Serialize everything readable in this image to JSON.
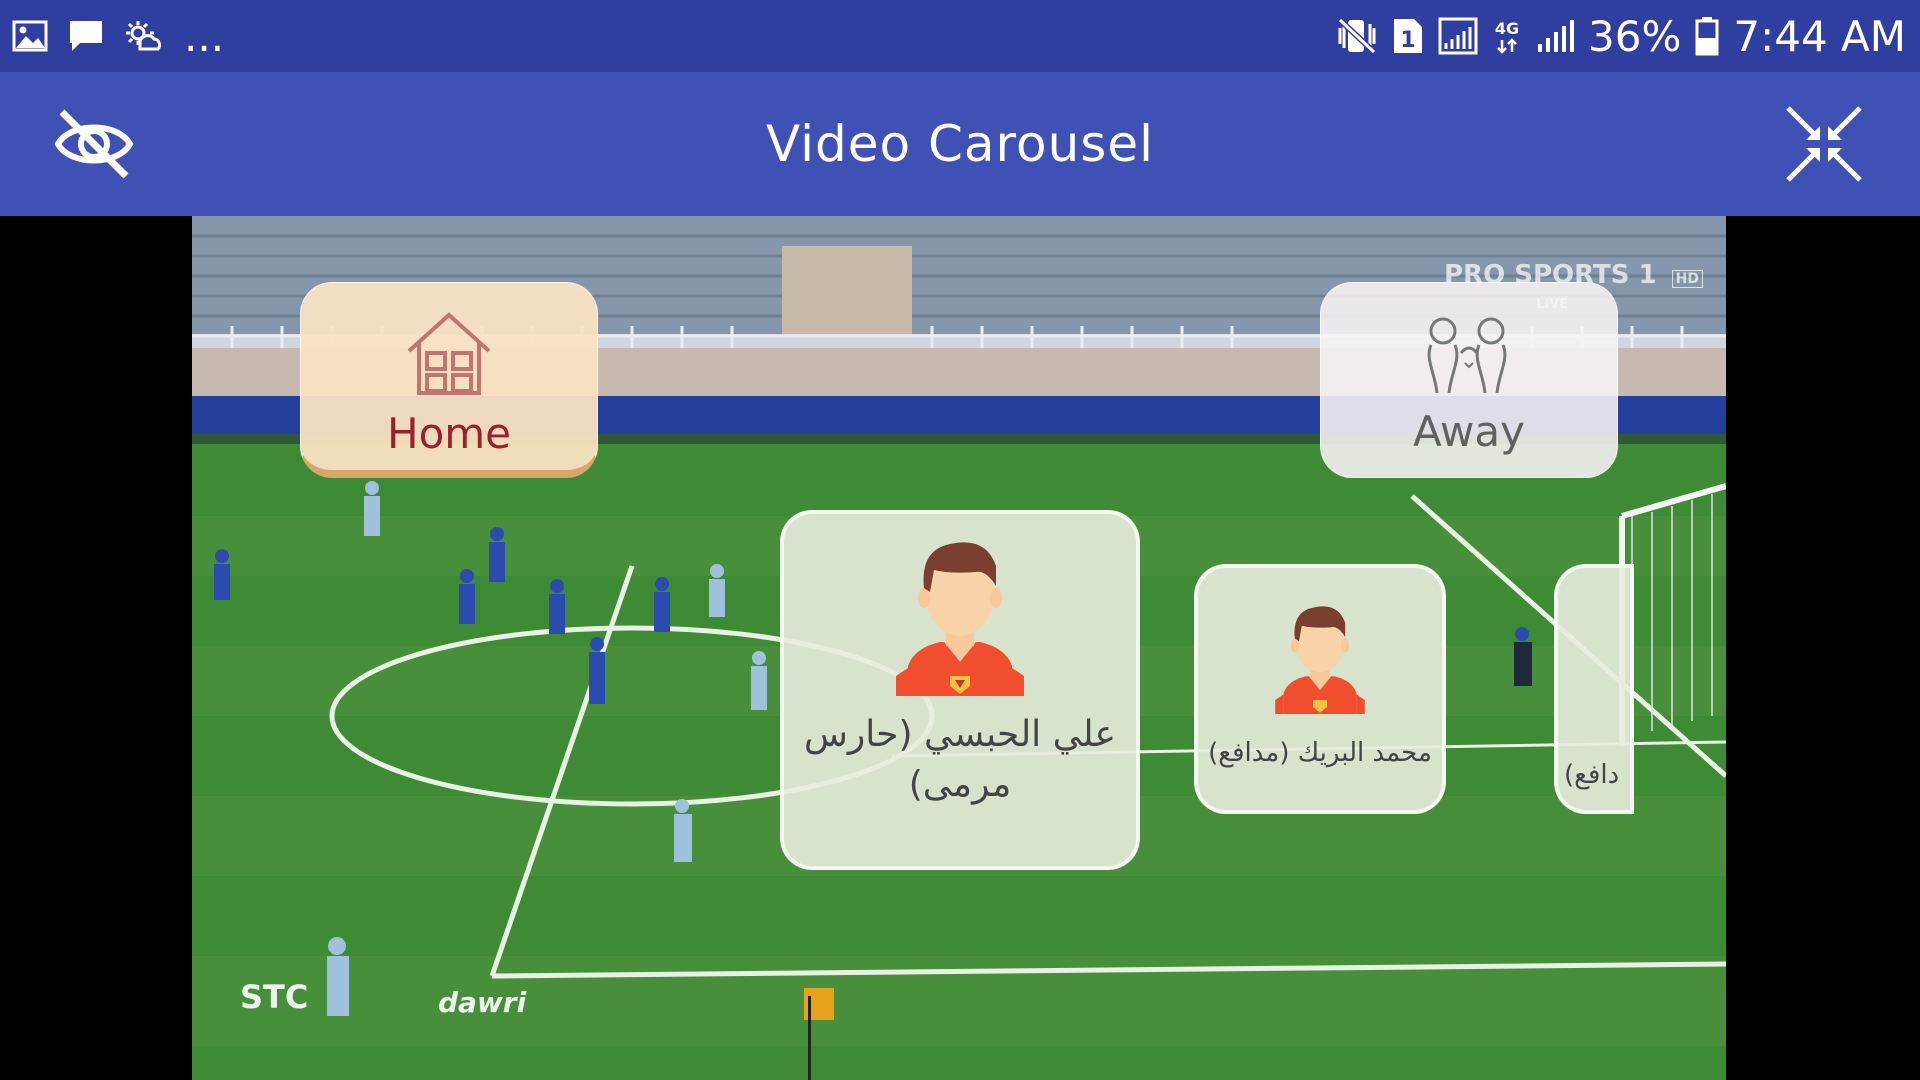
{
  "status_bar": {
    "left_icons": [
      "image-icon",
      "message-icon",
      "weather-icon"
    ],
    "overflow": "...",
    "sim_slot": "1",
    "network_type": "4G",
    "battery": "36%",
    "time": "7:44 AM"
  },
  "app_bar": {
    "title": "Video Carousel",
    "left_action_icon": "eye-off-icon",
    "right_action_icon": "collapse-icon"
  },
  "video": {
    "broadcaster_logo": "PRO SPORTS 1",
    "broadcaster_hd": "HD",
    "broadcaster_live": "LIVE",
    "sponsor_logo": "STC",
    "league_logo": "dawri"
  },
  "teams": {
    "home": {
      "label": "Home",
      "icon": "house-icon"
    },
    "away": {
      "label": "Away",
      "icon": "team-drawing-icon"
    }
  },
  "players": [
    {
      "name": "علي الحبسي (حارس مرمى)",
      "icon": "player-avatar-icon"
    },
    {
      "name": "محمد البريك (مدافع)",
      "icon": "player-avatar-icon"
    },
    {
      "name": "دافع)",
      "icon": "player-avatar-icon"
    }
  ],
  "colors": {
    "status_bar": "#303f9f",
    "app_bar": "#3f51b5",
    "home_text": "#9d1f2c",
    "jersey": "#f04e2f"
  }
}
